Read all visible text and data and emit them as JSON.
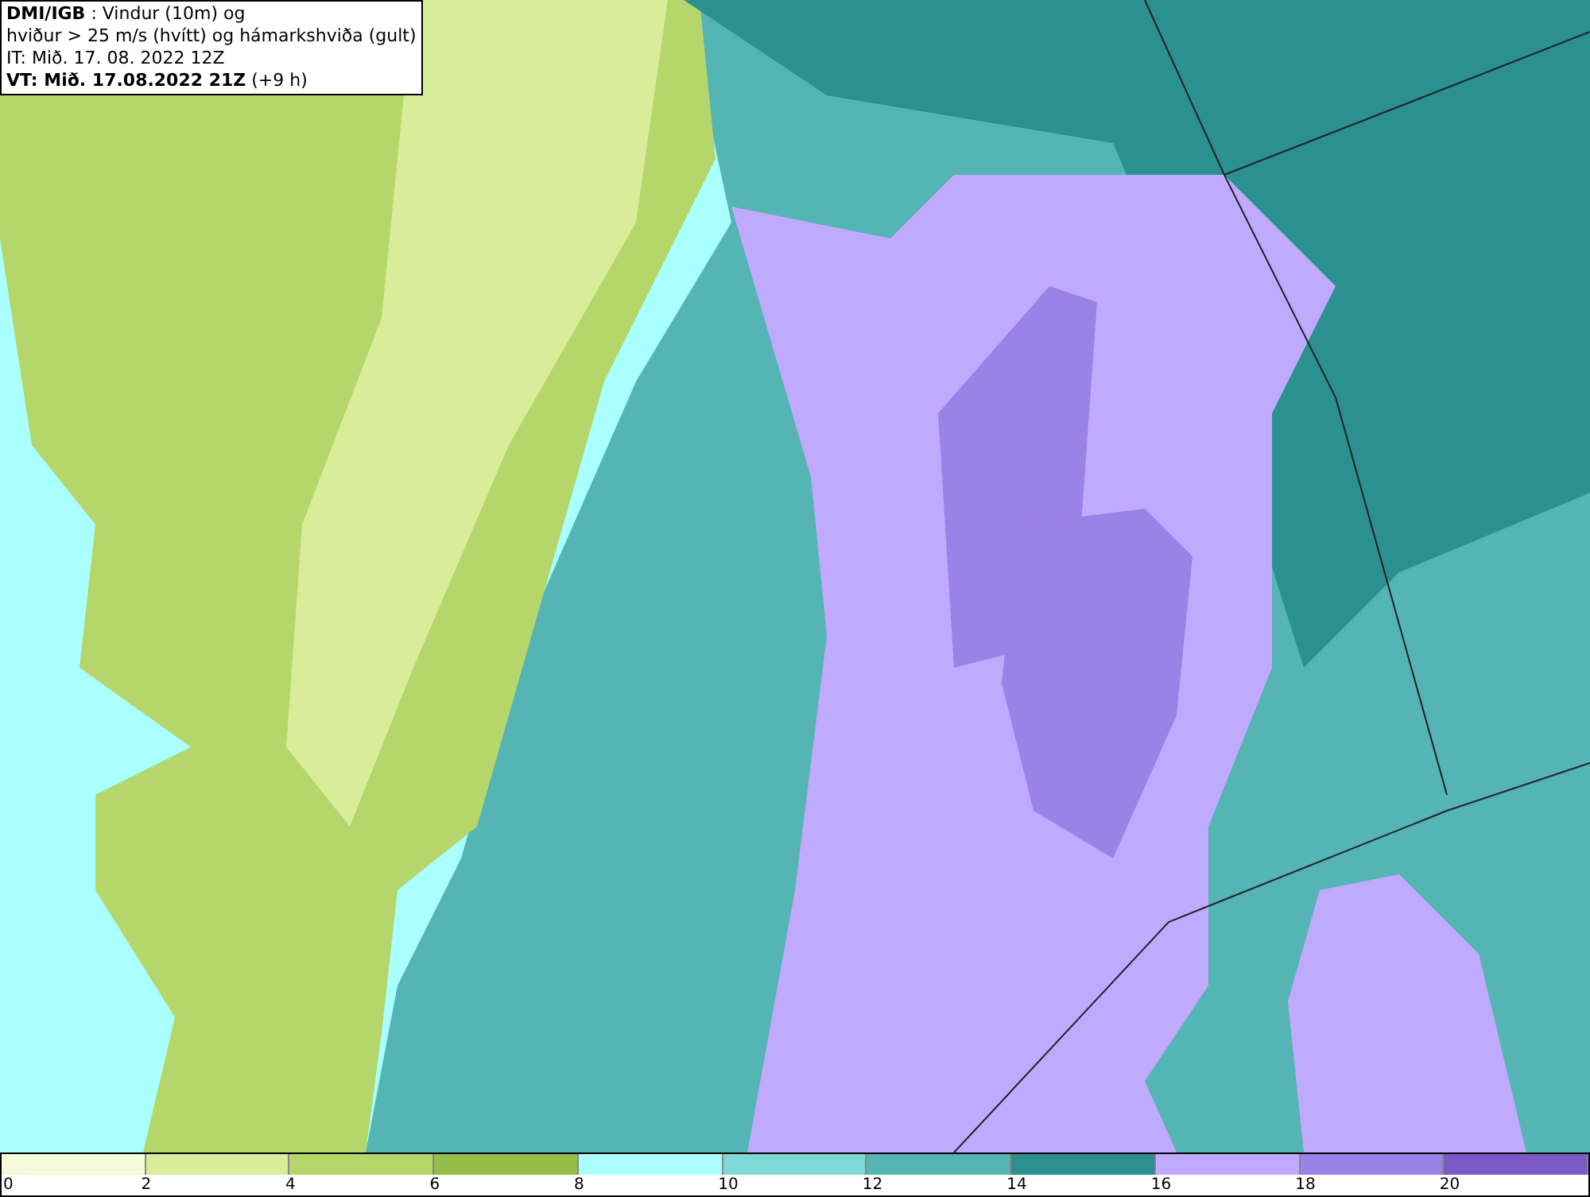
{
  "title_box": {
    "lines": [
      "**DMI/IGB** : Vindur (10m) og",
      "hviður > 25 m/s (hvítt) og hámarkshviða (gult)",
      "IT: Mið. 17. 08. 2022 12Z",
      "**VT: Mið. 17.08.2022 21Z** (+9 h)"
    ]
  },
  "legend": {
    "segments": [
      {
        "color": "#f5fad8",
        "label": "0"
      },
      {
        "color": "#d8ec9a",
        "label": "2"
      },
      {
        "color": "#b5d66a",
        "label": "4"
      },
      {
        "color": "#96bd48",
        "label": "6"
      },
      {
        "color": "#aaffff",
        "label": "8"
      },
      {
        "color": "#7fd8d8",
        "label": "10"
      },
      {
        "color": "#55b4b4",
        "label": "12"
      },
      {
        "color": "#2a9090",
        "label": "14"
      },
      {
        "color": "#c0aaff",
        "label": "16"
      },
      {
        "color": "#9b82e6",
        "label": "18"
      },
      {
        "color": "#7b5ac8",
        "label": "20"
      }
    ]
  }
}
